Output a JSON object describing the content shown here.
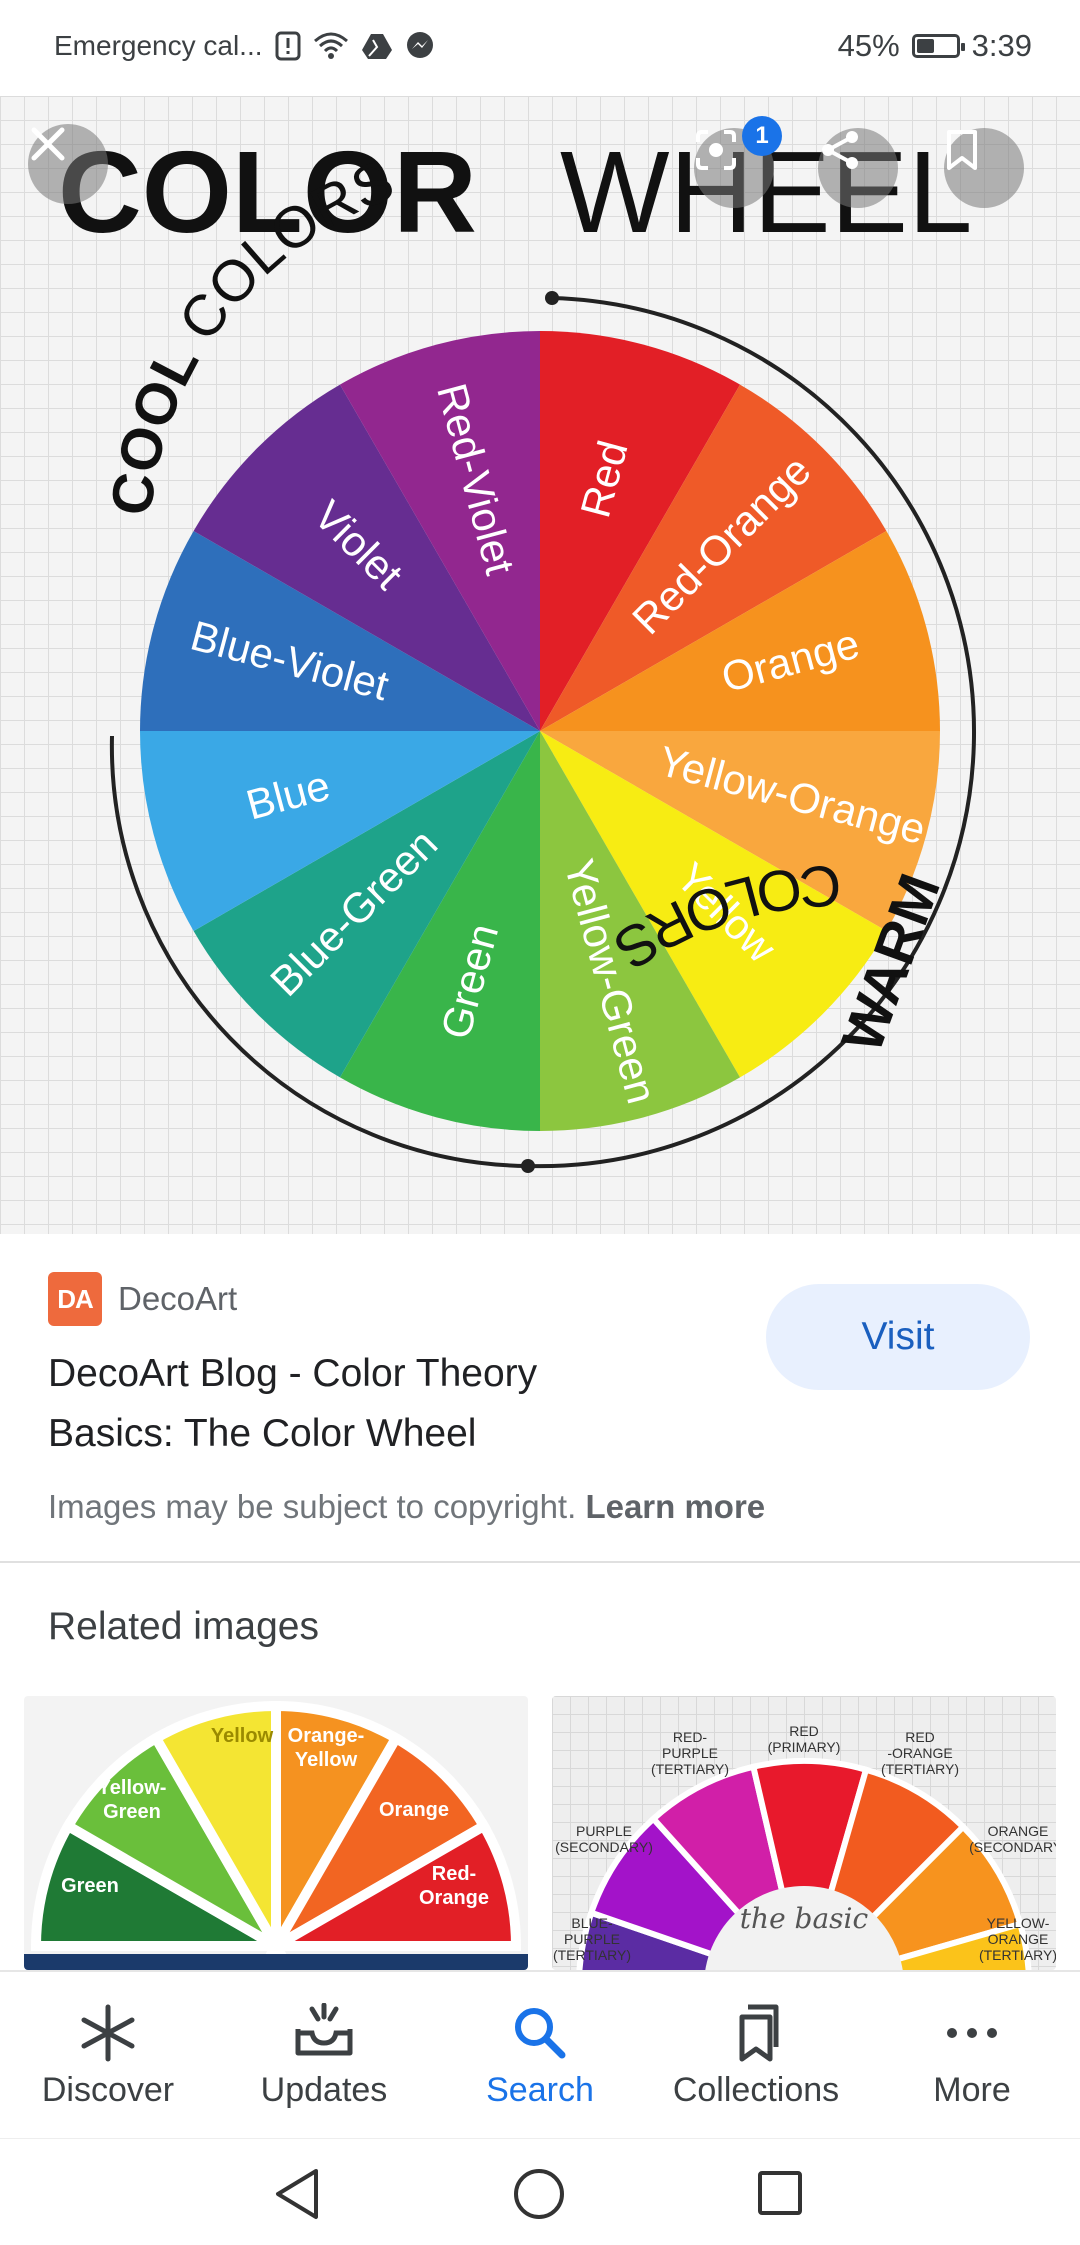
{
  "status_bar": {
    "left_text": "Emergency cal...",
    "battery": "45%",
    "battery_level": 0.45,
    "time": "3:39",
    "icons": [
      "alert-icon",
      "wifi-icon",
      "drive-icon",
      "messenger-icon"
    ]
  },
  "image": {
    "title_bold": "COLOR",
    "title_light": "WHEEL",
    "cool_bold": "COOL",
    "cool_light": "COLORS",
    "warm_bold": "WARM",
    "warm_light": "COLORS",
    "segments": [
      {
        "label": "Red",
        "color": "#e21f26"
      },
      {
        "label": "Red-Orange",
        "color": "#ef5a28"
      },
      {
        "label": "Orange",
        "color": "#f6921e"
      },
      {
        "label": "Yellow-Orange",
        "color": "#f9a73e"
      },
      {
        "label": "Yellow",
        "color": "#f7ec13"
      },
      {
        "label": "Yellow-Green",
        "color": "#8cc63f"
      },
      {
        "label": "Green",
        "color": "#39b54a"
      },
      {
        "label": "Blue-Green",
        "color": "#1ea38a"
      },
      {
        "label": "Blue",
        "color": "#3aa8e6"
      },
      {
        "label": "Blue-Violet",
        "color": "#2e6fbb"
      },
      {
        "label": "Violet",
        "color": "#662d91"
      },
      {
        "label": "Red-Violet",
        "color": "#92278f"
      }
    ]
  },
  "overlay": {
    "badge_count": "1",
    "buttons": [
      "close-icon",
      "lens-icon",
      "share-icon",
      "bookmark-icon"
    ]
  },
  "result": {
    "favicon": "DA",
    "source": "DecoArt",
    "title_line1": "DecoArt Blog - Color Theory",
    "title_line2": "Basics: The Color Wheel",
    "visit": "Visit",
    "copyright": "Images may be subject to copyright.",
    "learn_more": "Learn more"
  },
  "related": {
    "title": "Related images",
    "thumb1_labels": [
      "Yellow",
      "Orange-\nYellow",
      "Yellow-\nGreen",
      "Orange",
      "Green",
      "Red-\nOrange"
    ],
    "thumb2_labels": [
      "RED\n(PRIMARY)",
      "RED-\nPURPLE\n(TERTIARY)",
      "RED\n-ORANGE\n(TERTIARY)",
      "PURPLE\n(SECONDARY)",
      "ORANGE\n(SECONDARY)",
      "BLUE-\nPURPLE\n(TERTIARY)",
      "YELLOW-\nORANGE\n(TERTIARY)"
    ],
    "thumb2_script": "the basic"
  },
  "bottom_nav": {
    "items": [
      {
        "label": "Discover",
        "icon": "asterisk-icon"
      },
      {
        "label": "Updates",
        "icon": "updates-tray-icon"
      },
      {
        "label": "Search",
        "icon": "search-icon",
        "active": true
      },
      {
        "label": "Collections",
        "icon": "collections-icon"
      },
      {
        "label": "More",
        "icon": "more-dots-icon"
      }
    ]
  },
  "system_nav": [
    "back-icon",
    "home-icon",
    "recents-icon"
  ]
}
